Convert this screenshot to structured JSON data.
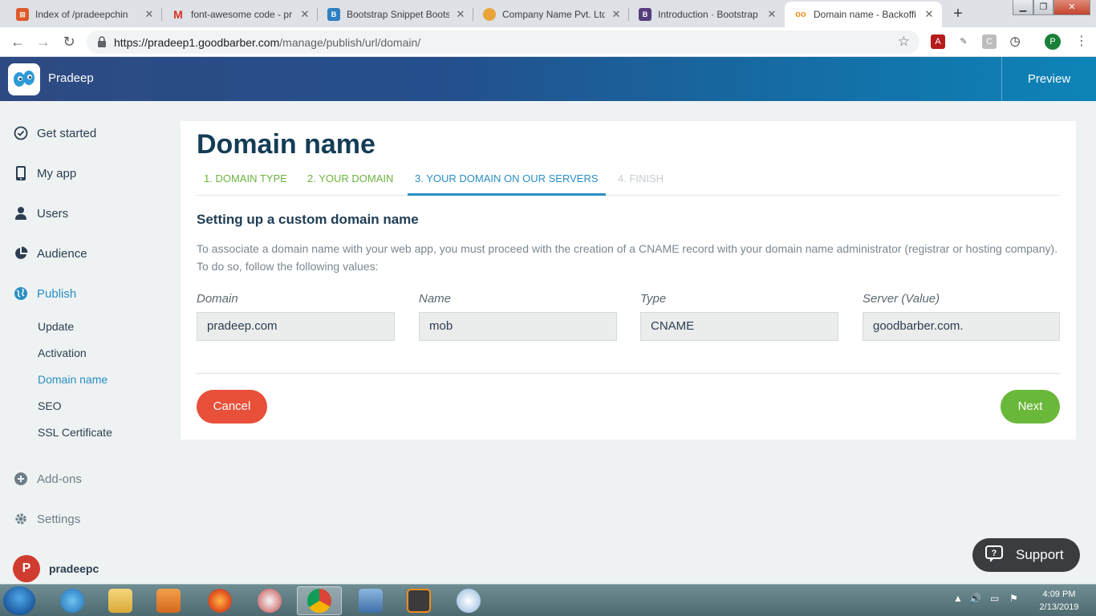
{
  "browser": {
    "tabs": [
      {
        "title": "Index of /pradeepchin",
        "favicon": "server-index-icon",
        "color": "#e05a2b"
      },
      {
        "title": "font-awesome code - pr",
        "favicon": "gmail-icon",
        "color": "#d93025"
      },
      {
        "title": "Bootstrap Snippet Boots",
        "favicon": "bootsnipp-icon",
        "color": "#2f7fc1"
      },
      {
        "title": "Company Name Pvt. Ltd.",
        "favicon": "globe-icon",
        "color": "#e9a53a"
      },
      {
        "title": "Introduction · Bootstrap",
        "favicon": "bootstrap-icon",
        "color": "#563d7c"
      },
      {
        "title": "Domain name - Backoffi",
        "favicon": "goodbarber-icon",
        "color": "#f08c1e"
      }
    ],
    "new_tab": "+",
    "url_host": "https://pradeep1.goodbarber.com",
    "url_path": "/manage/publish/url/domain/",
    "profile_initial": "P"
  },
  "header": {
    "app_name": "Pradeep",
    "preview_label": "Preview"
  },
  "sidebar": {
    "items": [
      {
        "label": "Get started",
        "icon": "check-circle-icon"
      },
      {
        "label": "My app",
        "icon": "mobile-icon"
      },
      {
        "label": "Users",
        "icon": "user-icon"
      },
      {
        "label": "Audience",
        "icon": "pie-chart-icon"
      },
      {
        "label": "Publish",
        "icon": "globe-icon"
      }
    ],
    "publish_sub": [
      "Update",
      "Activation",
      "Domain name",
      "SEO",
      "SSL Certificate"
    ],
    "bottom_items": [
      {
        "label": "Add-ons",
        "icon": "plus-circle-icon"
      },
      {
        "label": "Settings",
        "icon": "gear-icon"
      }
    ],
    "user": {
      "name": "pradeepc",
      "avatar_letter": "P"
    }
  },
  "main": {
    "title": "Domain name",
    "steps": [
      {
        "label": "1. DOMAIN TYPE",
        "state": "done"
      },
      {
        "label": "2. YOUR DOMAIN",
        "state": "done"
      },
      {
        "label": "3. YOUR DOMAIN ON OUR SERVERS",
        "state": "current"
      },
      {
        "label": "4. FINISH",
        "state": "todo"
      }
    ],
    "section_title": "Setting up a custom domain name",
    "description": "To associate a domain name with your web app, you must proceed with the creation of a CNAME record with your domain name administrator (registrar or hosting company). To do so, follow the following values:",
    "fields": [
      {
        "label": "Domain",
        "value": "pradeep.com"
      },
      {
        "label": "Name",
        "value": "mob"
      },
      {
        "label": "Type",
        "value": "CNAME"
      },
      {
        "label": "Server (Value)",
        "value": "goodbarber.com."
      }
    ],
    "cancel_label": "Cancel",
    "next_label": "Next"
  },
  "support": {
    "label": "Support"
  },
  "taskbar": {
    "apps": [
      "internet-explorer-icon",
      "file-explorer-icon",
      "media-player-icon",
      "firefox-icon",
      "snipping-tool-icon",
      "chrome-icon",
      "network-icon",
      "sublime-text-icon",
      "paint-icon"
    ],
    "time": "4:09 PM",
    "date": "2/13/2019"
  },
  "colors": {
    "accent": "#2a8ec4",
    "step_done": "#6cb33f",
    "cancel": "#e8503a",
    "next": "#6ab83a",
    "title": "#143c56"
  }
}
